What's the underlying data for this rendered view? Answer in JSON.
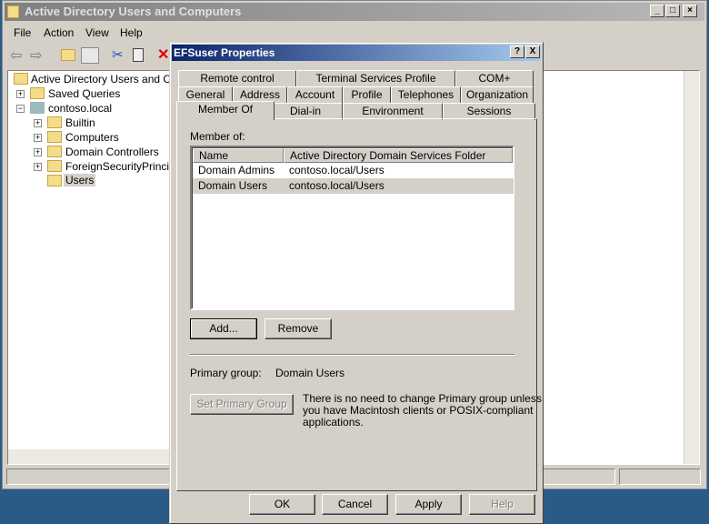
{
  "main_window": {
    "title": "Active Directory Users and Computers",
    "menu": [
      "File",
      "Action",
      "View",
      "Help"
    ]
  },
  "tree": {
    "root": "Active Directory Users and Computers",
    "items": [
      {
        "label": "Saved Queries",
        "indent": 1,
        "expander": "+"
      },
      {
        "label": "contoso.local",
        "indent": 1,
        "expander": "-"
      },
      {
        "label": "Builtin",
        "indent": 2,
        "expander": "+"
      },
      {
        "label": "Computers",
        "indent": 2,
        "expander": "+"
      },
      {
        "label": "Domain Controllers",
        "indent": 2,
        "expander": "+"
      },
      {
        "label": "ForeignSecurityPrincipals",
        "indent": 2,
        "expander": "+"
      },
      {
        "label": "Users",
        "indent": 2,
        "expander": "",
        "selected": true
      }
    ]
  },
  "dialog": {
    "title": "EFSuser Properties",
    "help_btn": "?",
    "close_btn": "X",
    "tabs_row1": [
      "Remote control",
      "Terminal Services Profile",
      "COM+"
    ],
    "tabs_row2": [
      "General",
      "Address",
      "Account",
      "Profile",
      "Telephones",
      "Organization"
    ],
    "tabs_row3": [
      "Member Of",
      "Dial-in",
      "Environment",
      "Sessions"
    ],
    "active_tab": "Member Of",
    "member_of_label": "Member of:",
    "columns": [
      "Name",
      "Active Directory Domain Services Folder"
    ],
    "rows": [
      {
        "name": "Domain Admins",
        "folder": "contoso.local/Users"
      },
      {
        "name": "Domain Users",
        "folder": "contoso.local/Users",
        "selected": true
      }
    ],
    "add": "Add...",
    "remove": "Remove",
    "primary_group_label": "Primary group:",
    "primary_group_value": "Domain Users",
    "set_primary": "Set Primary Group",
    "note_lines": [
      "There is no need to change Primary group unless",
      "you have Macintosh clients or POSIX-compliant",
      "applications."
    ],
    "ok": "OK",
    "cancel": "Cancel",
    "apply": "Apply",
    "help": "Help"
  }
}
